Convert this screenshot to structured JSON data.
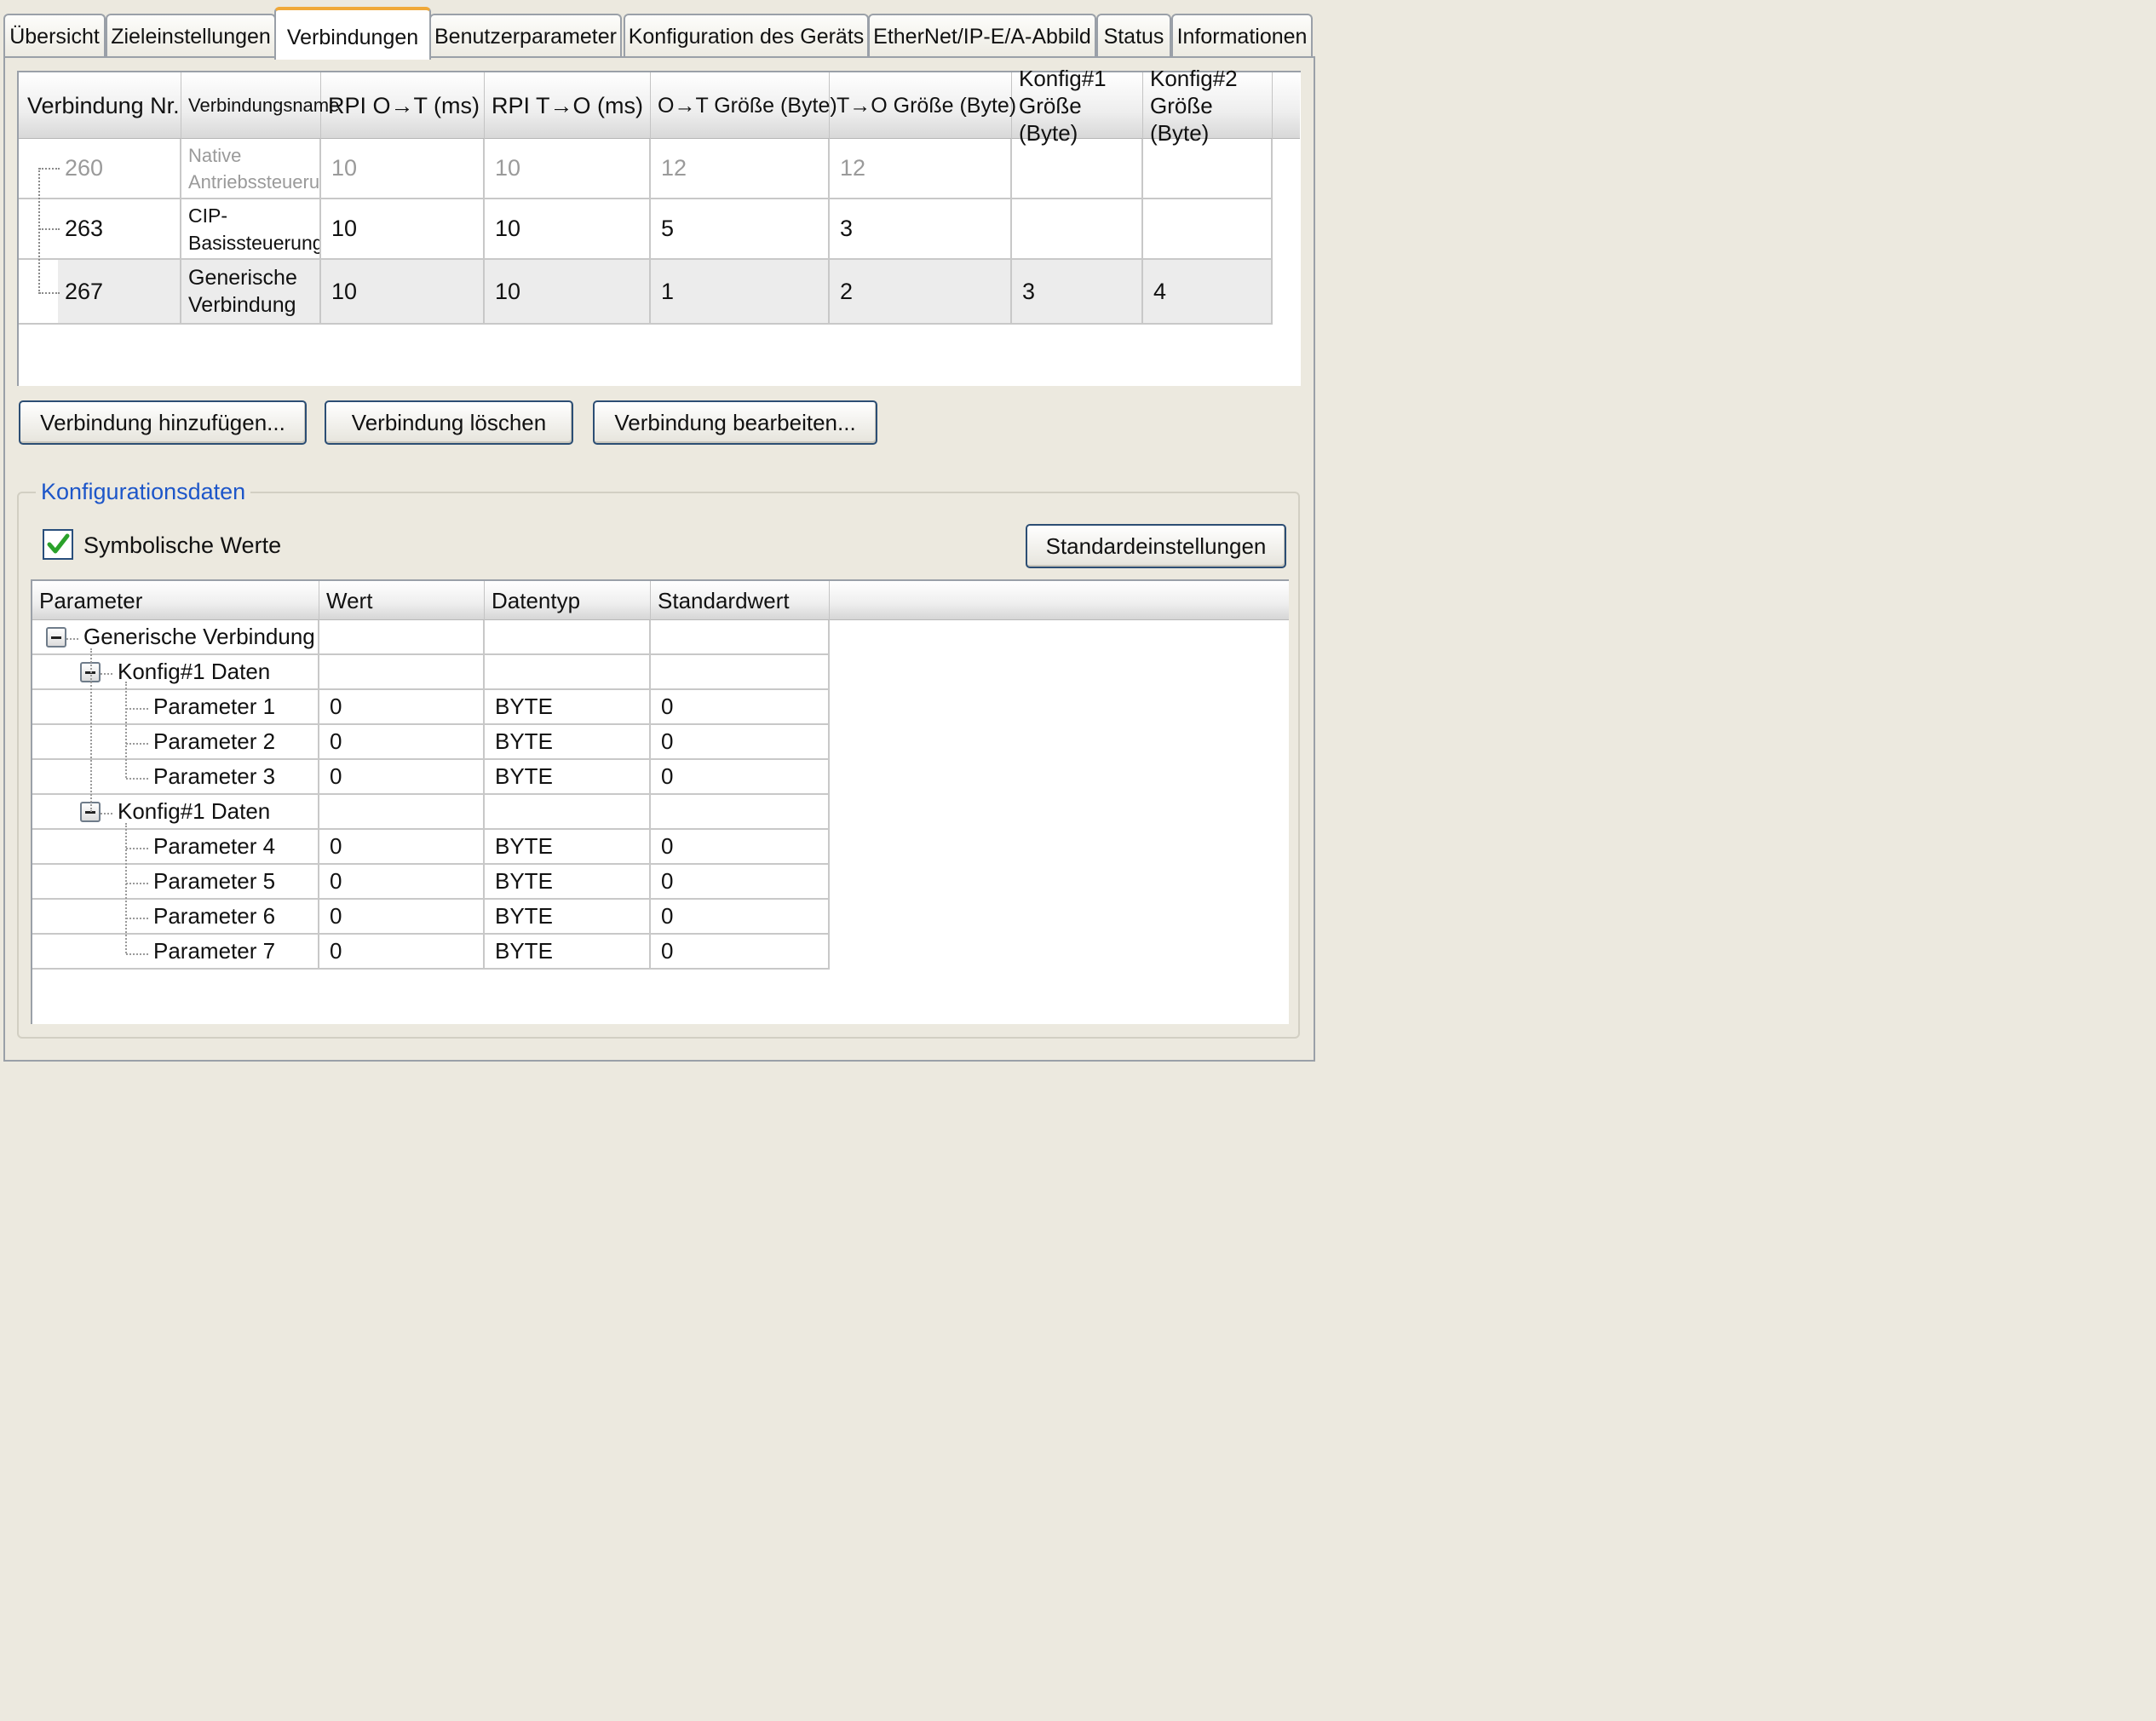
{
  "tabs": [
    {
      "label": "Übersicht"
    },
    {
      "label": "Zieleinstellungen"
    },
    {
      "label": "Verbindungen",
      "active": true
    },
    {
      "label": "Benutzerparameter"
    },
    {
      "label": "Konfiguration des Geräts"
    },
    {
      "label": "EtherNet/IP-E/A-Abbild"
    },
    {
      "label": "Status"
    },
    {
      "label": "Informationen"
    }
  ],
  "connections": {
    "columns": {
      "nr": "Verbindung Nr.",
      "name": "Verbindungsname",
      "rpi_ot": "RPI O→T (ms)",
      "rpi_to": "RPI T→O (ms)",
      "size_ot": "O→T Größe (Byte)",
      "size_to": "T→O Größe (Byte)",
      "konfig1": "Konfig#1 Größe (Byte)",
      "konfig2": "Konfig#2 Größe (Byte)"
    },
    "rows": [
      {
        "nr": "260",
        "name": "Native Antriebssteuerung",
        "rpi_ot": "10",
        "rpi_to": "10",
        "size_ot": "12",
        "size_to": "12",
        "konfig1": "",
        "konfig2": "",
        "disabled": true
      },
      {
        "nr": "263",
        "name": "CIP-Basissteuerung",
        "rpi_ot": "10",
        "rpi_to": "10",
        "size_ot": "5",
        "size_to": "3",
        "konfig1": "",
        "konfig2": ""
      },
      {
        "nr": "267",
        "name": "Generische Verbindung",
        "rpi_ot": "10",
        "rpi_to": "10",
        "size_ot": "1",
        "size_to": "2",
        "konfig1": "3",
        "konfig2": "4",
        "selected": true
      }
    ]
  },
  "buttons": {
    "add": "Verbindung hinzufügen...",
    "delete": "Verbindung löschen",
    "edit": "Verbindung bearbeiten...",
    "defaults": "Standardeinstellungen"
  },
  "config": {
    "group_title": "Konfigurationsdaten",
    "symbolic_label": "Symbolische Werte",
    "symbolic_checked": true,
    "columns": {
      "parameter": "Parameter",
      "value": "Wert",
      "type": "Datentyp",
      "default": "Standardwert"
    },
    "root": "Generische Verbindung",
    "groups": [
      {
        "label": "Konfig#1 Daten",
        "params": [
          {
            "name": "Parameter 1",
            "value": "0",
            "type": "BYTE",
            "default": "0"
          },
          {
            "name": "Parameter 2",
            "value": "0",
            "type": "BYTE",
            "default": "0"
          },
          {
            "name": "Parameter 3",
            "value": "0",
            "type": "BYTE",
            "default": "0"
          }
        ]
      },
      {
        "label": "Konfig#1 Daten",
        "params": [
          {
            "name": "Parameter 4",
            "value": "0",
            "type": "BYTE",
            "default": "0"
          },
          {
            "name": "Parameter 5",
            "value": "0",
            "type": "BYTE",
            "default": "0"
          },
          {
            "name": "Parameter 6",
            "value": "0",
            "type": "BYTE",
            "default": "0"
          },
          {
            "name": "Parameter 7",
            "value": "0",
            "type": "BYTE",
            "default": "0"
          }
        ]
      }
    ]
  },
  "colors": {
    "active_tab_accent": "#f0a838",
    "group_title": "#1d56c9",
    "check": "#2aa12a",
    "button_border": "#2c4e74"
  }
}
